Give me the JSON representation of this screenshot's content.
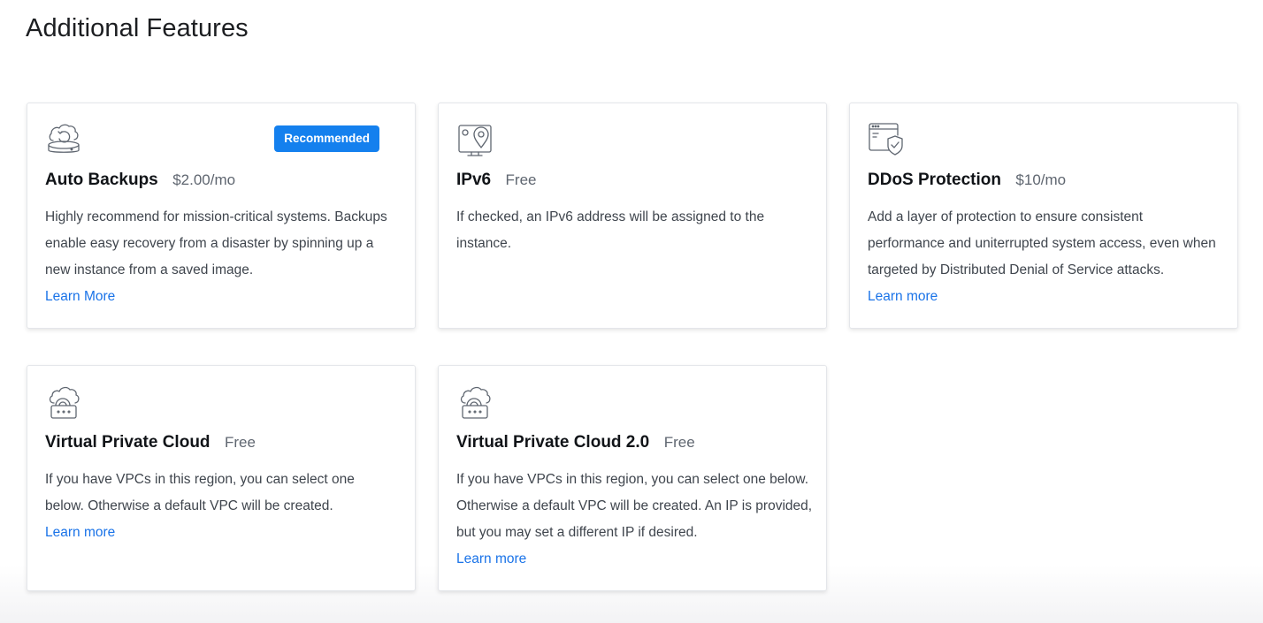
{
  "page": {
    "title": "Additional Features"
  },
  "features": [
    {
      "icon": "cloud-backup-icon",
      "name": "Auto Backups",
      "price": "$2.00/mo",
      "badge": "Recommended",
      "description": "Highly recommend for mission-critical systems. Backups enable easy recovery from a disaster by spinning up a new instance from a saved image.",
      "link": "Learn More"
    },
    {
      "icon": "ipv6-location-icon",
      "name": "IPv6",
      "price": "Free",
      "description": "If checked, an IPv6 address will be assigned to the instance."
    },
    {
      "icon": "shield-window-icon",
      "name": "DDoS Protection",
      "price": "$10/mo",
      "description": "Add a layer of protection to ensure consistent performance and uniterrupted system access, even when targeted by Distributed Denial of Service attacks.",
      "link": "Learn more"
    },
    {
      "icon": "cloud-lock-icon",
      "name": "Virtual Private Cloud",
      "price": "Free",
      "description": "If you have VPCs in this region, you can select one below. Otherwise a default VPC will be created.",
      "link": "Learn more"
    },
    {
      "icon": "cloud-lock-icon",
      "name": "Virtual Private Cloud 2.0",
      "price": "Free",
      "description": "If you have VPCs in this region, you can select one below. Otherwise a default VPC will be created. An IP is provided, but you may set a different IP if desired.",
      "link": "Learn more"
    }
  ],
  "colors": {
    "accent": "#1a73e8",
    "badge": "#1480ee",
    "icon_stroke": "#5f6670"
  }
}
